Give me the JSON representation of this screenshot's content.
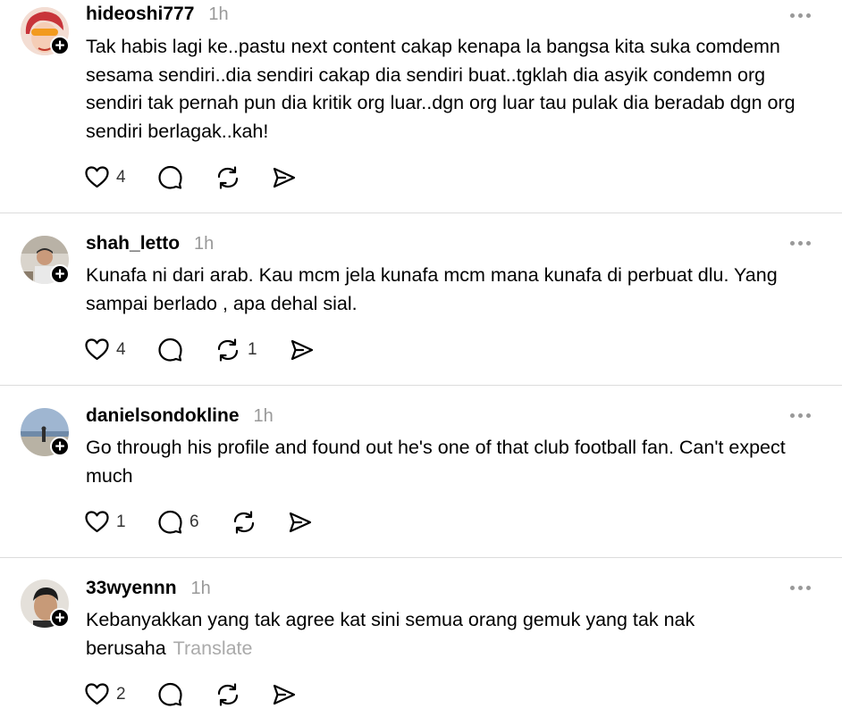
{
  "posts": [
    {
      "username": "hideoshi777",
      "time": "1h",
      "text": "Tak habis lagi ke..pastu next content cakap kenapa la bangsa kita suka comdemn sesama sendiri..dia sendiri cakap dia sendiri buat..tgklah dia asyik condemn org sendiri tak pernah pun dia kritik org luar..dgn org luar tau pulak dia beradab dgn org sendiri berlagak..kah!",
      "likes": "4",
      "replies": "",
      "reposts": ""
    },
    {
      "username": "shah_letto",
      "time": "1h",
      "text": "Kunafa ni dari arab. Kau mcm jela kunafa mcm mana kunafa di perbuat dlu. Yang sampai berlado , apa dehal sial.",
      "likes": "4",
      "replies": "",
      "reposts": "1"
    },
    {
      "username": "danielsondokline",
      "time": "1h",
      "text": "Go through his profile and found out he's one of that club football fan. Can't expect much",
      "likes": "1",
      "replies": "6",
      "reposts": ""
    },
    {
      "username": "33wyennn",
      "time": "1h",
      "text": "Kebanyakkan yang tak agree kat sini semua orang gemuk yang tak nak berusaha",
      "translate": "Translate",
      "likes": "2",
      "replies": "",
      "reposts": ""
    }
  ],
  "icons": {
    "like": "heart-icon",
    "reply": "comment-bubble-icon",
    "repost": "repost-icon",
    "share": "send-icon",
    "more": "more-dots-icon",
    "follow": "plus-icon"
  },
  "colors": {
    "text": "#000000",
    "muted": "#999999",
    "divider": "#dcdcdc"
  }
}
